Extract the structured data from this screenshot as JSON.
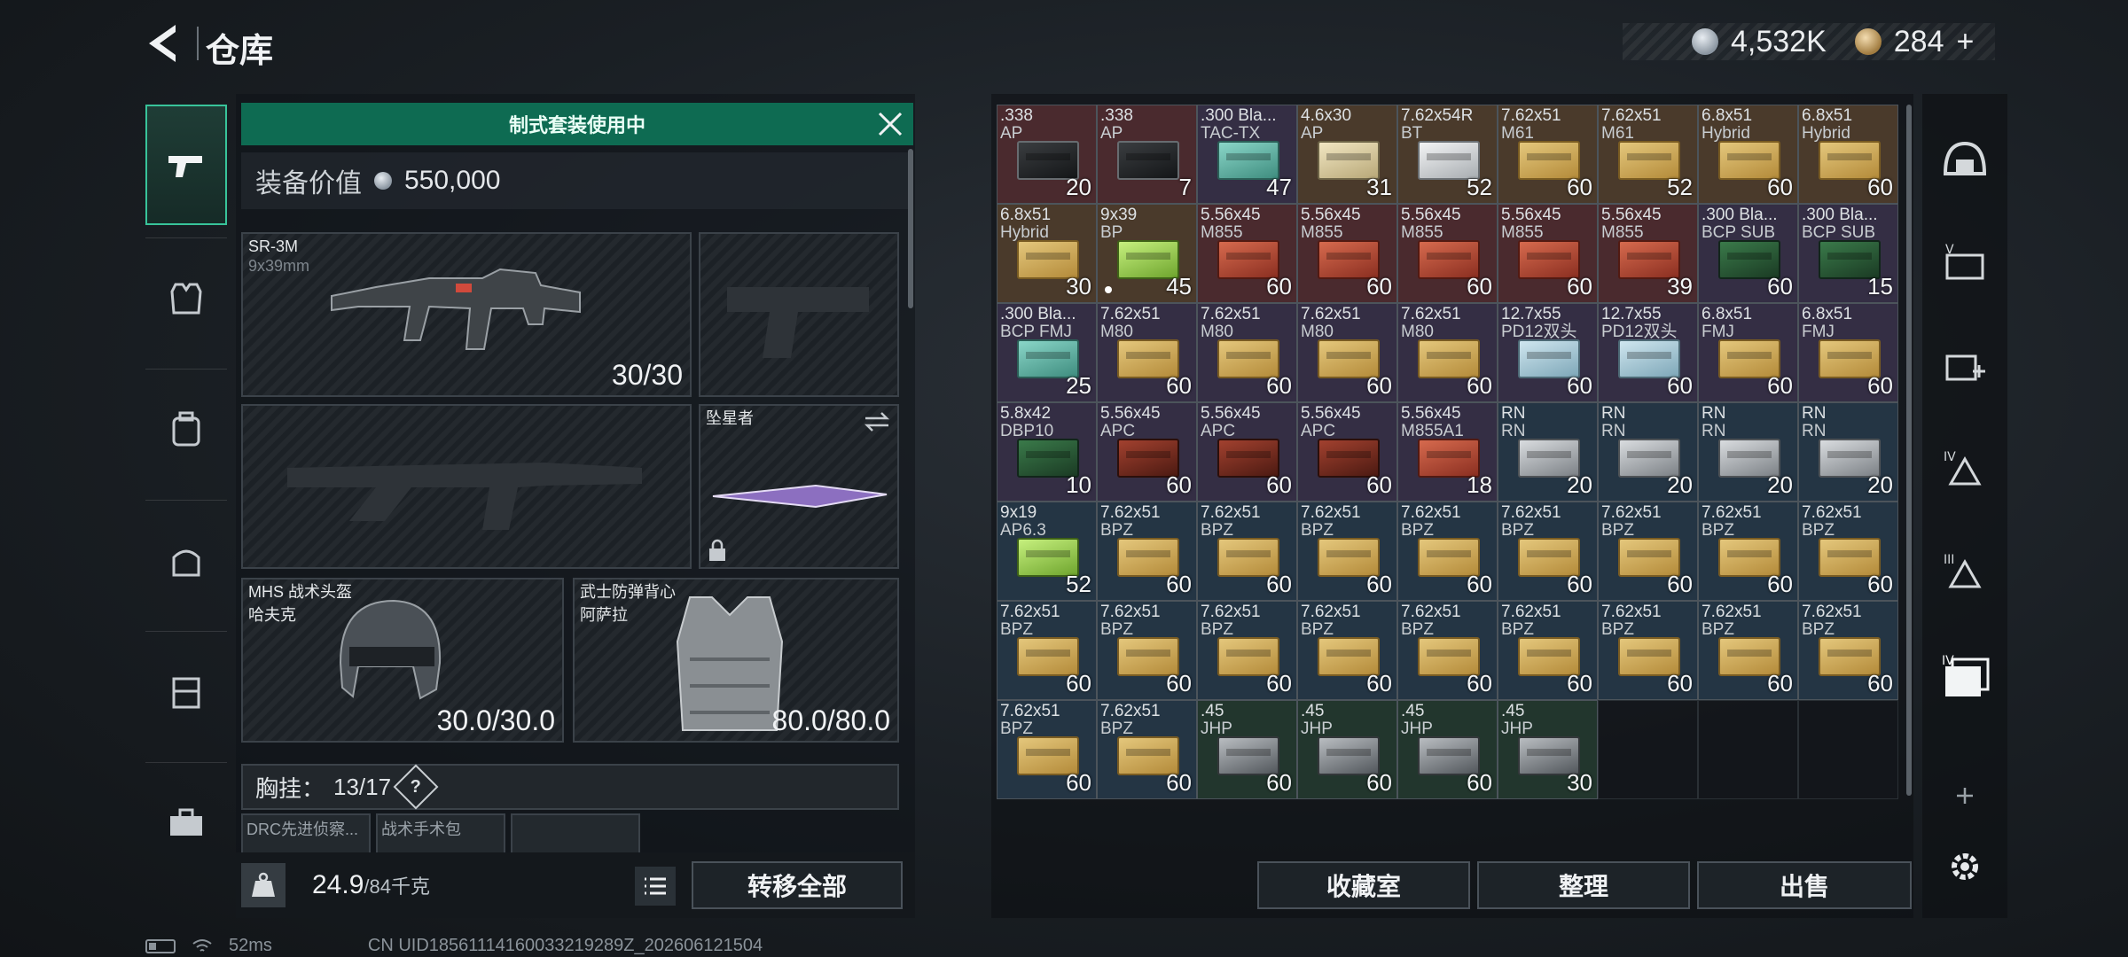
{
  "header": {
    "title": "仓库",
    "silver": "4,532K",
    "gold": "284",
    "gold_plus": "+"
  },
  "nav": {
    "categories": [
      "gun-icon",
      "vest-icon",
      "backpack-icon",
      "bag-icon",
      "rig-icon",
      "toolbox-icon"
    ]
  },
  "loadout": {
    "preset_banner": "制式套装使用中",
    "value_label": "装备价值",
    "value": "550,000",
    "primary": {
      "name": "SR-3M",
      "sub": "9x39mm",
      "ammo": "30/30"
    },
    "melee": {
      "name": "坠星者"
    },
    "helmet": {
      "name": "MHS 战术头盔",
      "sub": "哈夫克",
      "durability": "30.0/30.0"
    },
    "armor": {
      "name": "武士防弹背心",
      "sub": "阿萨拉",
      "durability": "80.0/80.0"
    },
    "chest_label": "胸挂：",
    "chest_value": "13/17",
    "chest_help": "?",
    "mini_slots": [
      "DRC先进侦察...",
      "战术手术包",
      ""
    ],
    "weight": "24.9",
    "weight_max": "/84千克",
    "transfer_all": "转移全部"
  },
  "inventory": {
    "cells": [
      {
        "name": ".338",
        "sub": "AP",
        "count": "20",
        "color": "red",
        "box": "black"
      },
      {
        "name": ".338",
        "sub": "AP",
        "count": "7",
        "color": "red",
        "box": "black"
      },
      {
        "name": ".300 Bla...",
        "sub": "TAC-TX",
        "count": "47",
        "color": "purple",
        "box": "teal"
      },
      {
        "name": "4.6x30",
        "sub": "AP",
        "count": "31",
        "color": "brown",
        "box": "cream"
      },
      {
        "name": "7.62x54R",
        "sub": "BT",
        "count": "52",
        "color": "brown",
        "box": "white"
      },
      {
        "name": "7.62x51",
        "sub": "M61",
        "count": "60",
        "color": "brown",
        "box": "tan"
      },
      {
        "name": "7.62x51",
        "sub": "M61",
        "count": "52",
        "color": "brown",
        "box": "tan"
      },
      {
        "name": "6.8x51",
        "sub": "Hybrid",
        "count": "60",
        "color": "brown",
        "box": "tan"
      },
      {
        "name": "6.8x51",
        "sub": "Hybrid",
        "count": "60",
        "color": "brown",
        "box": "tan"
      },
      {
        "name": "6.8x51",
        "sub": "Hybrid",
        "count": "30",
        "color": "brown",
        "box": "tan"
      },
      {
        "name": "9x39",
        "sub": "BP",
        "count": "45",
        "color": "brown",
        "box": "green",
        "dot": true
      },
      {
        "name": "5.56x45",
        "sub": "M855",
        "count": "60",
        "color": "red",
        "box": "rust"
      },
      {
        "name": "5.56x45",
        "sub": "M855",
        "count": "60",
        "color": "red",
        "box": "rust"
      },
      {
        "name": "5.56x45",
        "sub": "M855",
        "count": "60",
        "color": "red",
        "box": "rust"
      },
      {
        "name": "5.56x45",
        "sub": "M855",
        "count": "60",
        "color": "red",
        "box": "rust"
      },
      {
        "name": "5.56x45",
        "sub": "M855",
        "count": "39",
        "color": "red",
        "box": "rust"
      },
      {
        "name": ".300 Bla...",
        "sub": "BCP SUB",
        "count": "60",
        "color": "purple",
        "box": "darkgreen"
      },
      {
        "name": ".300 Bla...",
        "sub": "BCP SUB",
        "count": "15",
        "color": "purple",
        "box": "darkgreen"
      },
      {
        "name": ".300 Bla...",
        "sub": "BCP FMJ",
        "count": "25",
        "color": "purple",
        "box": "teal"
      },
      {
        "name": "7.62x51",
        "sub": "M80",
        "count": "60",
        "color": "purple",
        "box": "tan"
      },
      {
        "name": "7.62x51",
        "sub": "M80",
        "count": "60",
        "color": "purple",
        "box": "tan"
      },
      {
        "name": "7.62x51",
        "sub": "M80",
        "count": "60",
        "color": "purple",
        "box": "tan"
      },
      {
        "name": "7.62x51",
        "sub": "M80",
        "count": "60",
        "color": "purple",
        "box": "tan"
      },
      {
        "name": "12.7x55",
        "sub": "PD12双头",
        "count": "60",
        "color": "purple",
        "box": "sky"
      },
      {
        "name": "12.7x55",
        "sub": "PD12双头",
        "count": "60",
        "color": "purple",
        "box": "sky"
      },
      {
        "name": "6.8x51",
        "sub": "FMJ",
        "count": "60",
        "color": "purple",
        "box": "tan"
      },
      {
        "name": "6.8x51",
        "sub": "FMJ",
        "count": "60",
        "color": "purple",
        "box": "tan"
      },
      {
        "name": "5.8x42",
        "sub": "DBP10",
        "count": "10",
        "color": "purple",
        "box": "darkgreen"
      },
      {
        "name": "5.56x45",
        "sub": "APC",
        "count": "60",
        "color": "purple",
        "box": "bullets"
      },
      {
        "name": "5.56x45",
        "sub": "APC",
        "count": "60",
        "color": "purple",
        "box": "bullets"
      },
      {
        "name": "5.56x45",
        "sub": "APC",
        "count": "60",
        "color": "purple",
        "box": "bullets"
      },
      {
        "name": "5.56x45",
        "sub": "M855A1",
        "count": "18",
        "color": "purple",
        "box": "rust"
      },
      {
        "name": "RN",
        "sub": "RN",
        "count": "20",
        "color": "blue",
        "box": "gray"
      },
      {
        "name": "RN",
        "sub": "RN",
        "count": "20",
        "color": "blue",
        "box": "gray"
      },
      {
        "name": "RN",
        "sub": "RN",
        "count": "20",
        "color": "blue",
        "box": "gray"
      },
      {
        "name": "RN",
        "sub": "RN",
        "count": "20",
        "color": "blue",
        "box": "gray"
      },
      {
        "name": "9x19",
        "sub": "AP6.3",
        "count": "52",
        "color": "blue",
        "box": "green"
      },
      {
        "name": "7.62x51",
        "sub": "BPZ",
        "count": "60",
        "color": "blue",
        "box": "tan"
      },
      {
        "name": "7.62x51",
        "sub": "BPZ",
        "count": "60",
        "color": "blue",
        "box": "tan"
      },
      {
        "name": "7.62x51",
        "sub": "BPZ",
        "count": "60",
        "color": "blue",
        "box": "tan"
      },
      {
        "name": "7.62x51",
        "sub": "BPZ",
        "count": "60",
        "color": "blue",
        "box": "tan"
      },
      {
        "name": "7.62x51",
        "sub": "BPZ",
        "count": "60",
        "color": "blue",
        "box": "tan"
      },
      {
        "name": "7.62x51",
        "sub": "BPZ",
        "count": "60",
        "color": "blue",
        "box": "tan"
      },
      {
        "name": "7.62x51",
        "sub": "BPZ",
        "count": "60",
        "color": "blue",
        "box": "tan"
      },
      {
        "name": "7.62x51",
        "sub": "BPZ",
        "count": "60",
        "color": "blue",
        "box": "tan"
      },
      {
        "name": "7.62x51",
        "sub": "BPZ",
        "count": "60",
        "color": "blue",
        "box": "tan"
      },
      {
        "name": "7.62x51",
        "sub": "BPZ",
        "count": "60",
        "color": "blue",
        "box": "tan"
      },
      {
        "name": "7.62x51",
        "sub": "BPZ",
        "count": "60",
        "color": "blue",
        "box": "tan"
      },
      {
        "name": "7.62x51",
        "sub": "BPZ",
        "count": "60",
        "color": "blue",
        "box": "tan"
      },
      {
        "name": "7.62x51",
        "sub": "BPZ",
        "count": "60",
        "color": "blue",
        "box": "tan"
      },
      {
        "name": "7.62x51",
        "sub": "BPZ",
        "count": "60",
        "color": "blue",
        "box": "tan"
      },
      {
        "name": "7.62x51",
        "sub": "BPZ",
        "count": "60",
        "color": "blue",
        "box": "tan"
      },
      {
        "name": "7.62x51",
        "sub": "BPZ",
        "count": "60",
        "color": "blue",
        "box": "tan"
      },
      {
        "name": "7.62x51",
        "sub": "BPZ",
        "count": "60",
        "color": "blue",
        "box": "tan"
      },
      {
        "name": "7.62x51",
        "sub": "BPZ",
        "count": "60",
        "color": "blue",
        "box": "tan"
      },
      {
        "name": "7.62x51",
        "sub": "BPZ",
        "count": "60",
        "color": "blue",
        "box": "tan"
      },
      {
        "name": ".45",
        "sub": "JHP",
        "count": "60",
        "color": "green",
        "box": "slate"
      },
      {
        "name": ".45",
        "sub": "JHP",
        "count": "60",
        "color": "green",
        "box": "slate"
      },
      {
        "name": ".45",
        "sub": "JHP",
        "count": "60",
        "color": "green",
        "box": "slate"
      },
      {
        "name": ".45",
        "sub": "JHP",
        "count": "30",
        "color": "green",
        "box": "slate"
      }
    ],
    "actions": [
      "收藏室",
      "整理",
      "出售"
    ]
  },
  "filters": [
    "helmet-filter-icon",
    "armor-v-filter-icon",
    "medkit-filter-icon",
    "armor-iv-filter-icon",
    "armor-iii-filter-icon",
    "case-iv-filter-icon"
  ],
  "status": {
    "ping": "52ms",
    "uid": "CN UID18561114160033219289Z_202606121504"
  }
}
